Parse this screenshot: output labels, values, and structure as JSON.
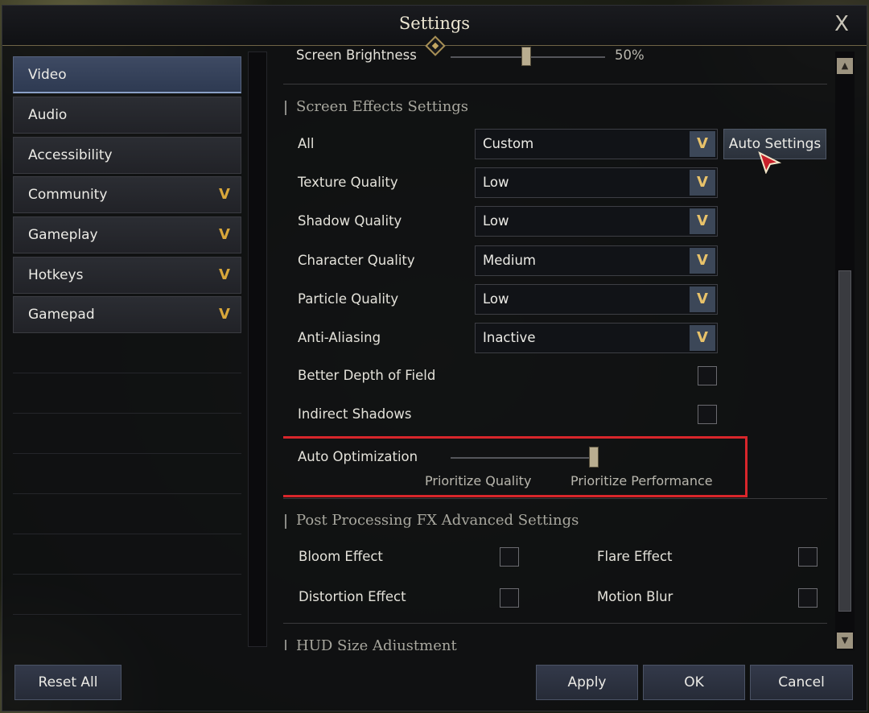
{
  "window": {
    "title": "Settings",
    "close_glyph": "X"
  },
  "sidebar": {
    "items": [
      {
        "label": "Video",
        "active": true,
        "has_chevron": false
      },
      {
        "label": "Audio",
        "has_chevron": false
      },
      {
        "label": "Accessibility",
        "has_chevron": false
      },
      {
        "label": "Community",
        "has_chevron": true
      },
      {
        "label": "Gameplay",
        "has_chevron": true
      },
      {
        "label": "Hotkeys",
        "has_chevron": true
      },
      {
        "label": "Gamepad",
        "has_chevron": true
      }
    ],
    "chevron_glyph": "V"
  },
  "content": {
    "brightness": {
      "label": "Screen Brightness",
      "value": "50%"
    },
    "screen_effects": {
      "title": "Screen Effects Settings",
      "all": {
        "label": "All",
        "value": "Custom"
      },
      "auto_settings_label": "Auto Settings",
      "texture": {
        "label": "Texture Quality",
        "value": "Low"
      },
      "shadow": {
        "label": "Shadow Quality",
        "value": "Low"
      },
      "character": {
        "label": "Character Quality",
        "value": "Medium"
      },
      "particle": {
        "label": "Particle Quality",
        "value": "Low"
      },
      "antialias": {
        "label": "Anti-Aliasing",
        "value": "Inactive"
      },
      "depth_of_field": {
        "label": "Better Depth of Field",
        "checked": false
      },
      "indirect_shadows": {
        "label": "Indirect Shadows",
        "checked": false
      },
      "auto_optimization": {
        "label": "Auto Optimization",
        "left_label": "Prioritize Quality",
        "right_label": "Prioritize Performance",
        "value_fraction": 1.0
      }
    },
    "post_processing": {
      "title": "Post Processing FX Advanced Settings",
      "bloom": {
        "label": "Bloom Effect",
        "checked": false
      },
      "flare": {
        "label": "Flare Effect",
        "checked": false
      },
      "distortion": {
        "label": "Distortion Effect",
        "checked": false
      },
      "motion_blur": {
        "label": "Motion Blur",
        "checked": false
      }
    },
    "hud": {
      "title": "HUD Size Adjustment"
    }
  },
  "dropdown_arrow_glyph": "V",
  "scrollbar": {
    "up_glyph": "▲",
    "down_glyph": "▼"
  },
  "footer": {
    "reset_label": "Reset All",
    "apply_label": "Apply",
    "ok_label": "OK",
    "cancel_label": "Cancel"
  },
  "colors": {
    "accent_gold": "#d9a73a",
    "active_tab": "#3e4a63",
    "highlight_red": "#d8262b"
  }
}
